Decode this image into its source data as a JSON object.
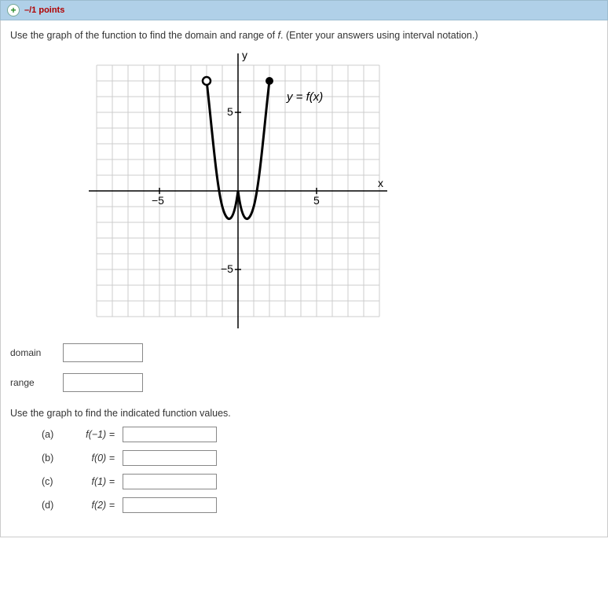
{
  "header": {
    "points": "–/1 points"
  },
  "prompt": "Use the graph of the function to find the domain and range of ",
  "prompt_var": "f",
  "prompt_tail": ". (Enter your answers using interval notation.)",
  "graph": {
    "y_label": "y",
    "x_label": "x",
    "eq_label": "y = f(x)",
    "tick_neg5_x": "−5",
    "tick_pos5_x": "5",
    "tick_pos5_y": "5",
    "tick_neg5_y": "−5"
  },
  "answers": {
    "domain_label": "domain",
    "range_label": "range",
    "domain_value": "",
    "range_value": ""
  },
  "sub_prompt": "Use the graph to find the indicated function values.",
  "parts": [
    {
      "letter": "(a)",
      "expr": "f(−1) =",
      "value": ""
    },
    {
      "letter": "(b)",
      "expr": "f(0) =",
      "value": ""
    },
    {
      "letter": "(c)",
      "expr": "f(1) =",
      "value": ""
    },
    {
      "letter": "(d)",
      "expr": "f(2) =",
      "value": ""
    }
  ],
  "chart_data": {
    "type": "line",
    "title": "y = f(x)",
    "xlabel": "x",
    "ylabel": "y",
    "xlim": [
      -9,
      9
    ],
    "ylim": [
      -9,
      9
    ],
    "xticks_labeled": [
      -5,
      5
    ],
    "yticks_labeled": [
      -5,
      5
    ],
    "open_endpoint": {
      "x": -2,
      "y": 7
    },
    "closed_endpoint": {
      "x": 2,
      "y": 7
    },
    "curve_points": [
      {
        "x": -2,
        "y": 7
      },
      {
        "x": -1.5,
        "y": 2.5
      },
      {
        "x": -1,
        "y": -1
      },
      {
        "x": -0.5,
        "y": -2
      },
      {
        "x": 0,
        "y": 0
      },
      {
        "x": 0.5,
        "y": -2
      },
      {
        "x": 1,
        "y": -1
      },
      {
        "x": 1.5,
        "y": 2.5
      },
      {
        "x": 2,
        "y": 7
      }
    ],
    "annotations": [
      {
        "text": "y = f(x)",
        "x": 3.2,
        "y": 6
      }
    ]
  }
}
